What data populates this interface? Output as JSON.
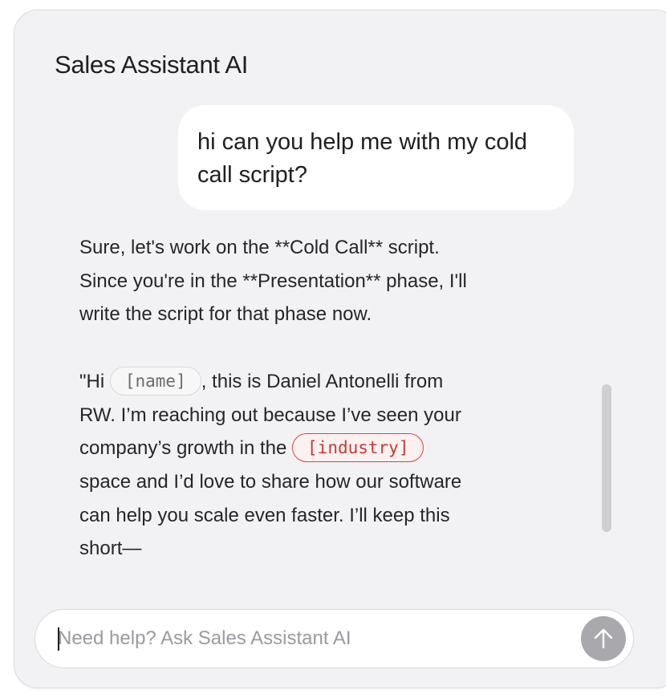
{
  "app": {
    "title": "Sales Assistant AI"
  },
  "chat": {
    "user_message": "hi can you help me with my cold call script?",
    "assistant": {
      "para1": "Sure, let's work on the **Cold Call** script. Since you're in the **Presentation** phase, I'll write the script for that phase now.",
      "para2_prefix": "\"Hi ",
      "chip_name": "[name]",
      "para2_mid": ", this is Daniel Antonelli from RW. I’m reaching out because I’ve seen your company’s growth in the ",
      "chip_industry": "[industry]",
      "para2_suffix": " space and I’d love to share how our software can help you scale even faster. I’ll keep this short—"
    }
  },
  "composer": {
    "placeholder": "Need help? Ask Sales Assistant AI",
    "value": "",
    "send_icon": "arrow-up-icon"
  },
  "colors": {
    "panel_bg": "#f2f2f4",
    "send_button": "#a9a9ad",
    "chip_error": "#d9443c"
  }
}
